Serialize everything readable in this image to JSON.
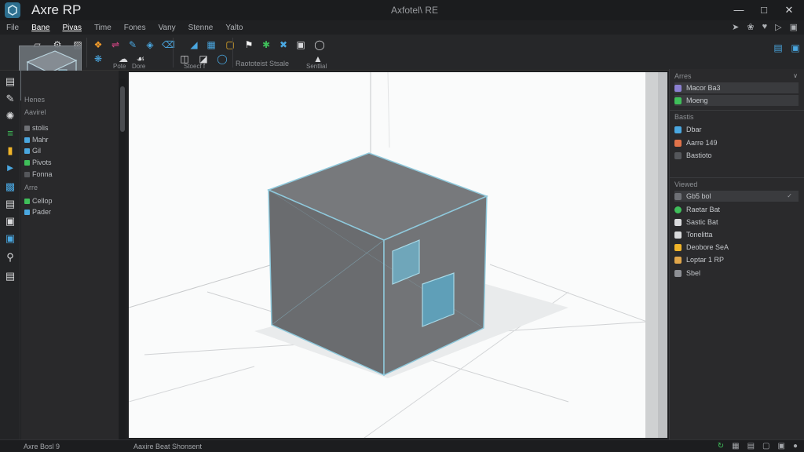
{
  "window": {
    "app_title": "Axre RP",
    "document_title": "Axfotel\\ RE",
    "min_icon": "minimize-icon",
    "max_icon": "maximize-icon",
    "close_icon": "close-icon"
  },
  "menu": {
    "items": [
      "File",
      "Bane",
      "Pivas",
      "Time",
      "Fones",
      "Vany",
      "Stenne",
      "Yalto"
    ],
    "active_index": 1
  },
  "toolbar": {
    "labels": [
      "Pote",
      "Dore",
      "Stoecf f",
      "Raototeist Stsale",
      "Sentlial"
    ]
  },
  "left_panel": {
    "headings": [
      "Henes",
      "Aavirel",
      "Arre"
    ],
    "items": [
      "stolis",
      "Mahr",
      "Gil",
      "Pivots",
      "Fonna",
      "Cellop",
      "Pader"
    ]
  },
  "right_panel": {
    "section1_items": [
      "Macor Ba3",
      "Moeng"
    ],
    "section2_heading": "Bastis",
    "section2_items": [
      "Dbar",
      "Aarre 149",
      "Bastioto"
    ],
    "section3_heading": "Viewed",
    "section3_items": [
      "Gb5 bol",
      "Raetar Bat",
      "Sastic Bat",
      "Tonelitta",
      "Deobore SeA",
      "Loptar 1 RP",
      "Sbel"
    ]
  },
  "statusbar": {
    "left": "Axre Bosl 9",
    "middle": "Aaxire Beat Shonsent"
  },
  "colors": {
    "accent_green": "#3fa34d",
    "accent_blue": "#3a8fc4",
    "cube_edge": "#8fc9dc",
    "cube_fill": "#6b6d70"
  }
}
